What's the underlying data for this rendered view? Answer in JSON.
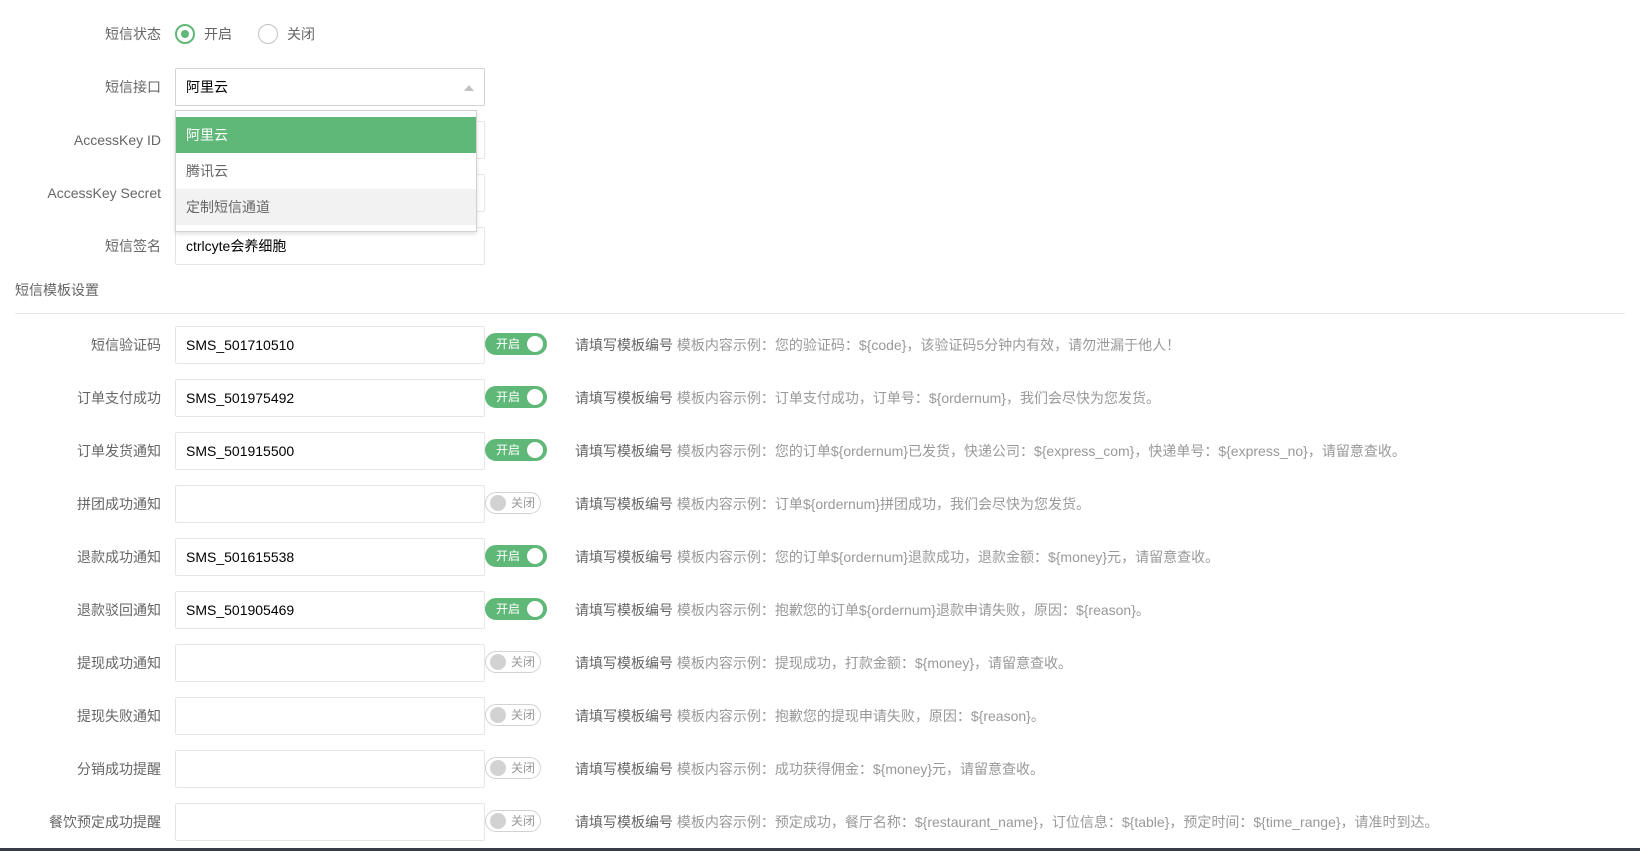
{
  "sms_status": {
    "label": "短信状态",
    "options": [
      {
        "label": "开启",
        "checked": true
      },
      {
        "label": "关闭",
        "checked": false
      }
    ]
  },
  "sms_gateway": {
    "label": "短信接口",
    "value": "阿里云",
    "options": [
      "阿里云",
      "腾讯云",
      "定制短信通道"
    ],
    "selected_index": 0,
    "hover_index": 2
  },
  "access_key_id": {
    "label": "AccessKey ID",
    "value": ""
  },
  "access_key_secret": {
    "label": "AccessKey Secret",
    "value": ""
  },
  "sms_sign": {
    "label": "短信签名",
    "value": "ctrlcyte会养细胞"
  },
  "template_section": {
    "title": "短信模板设置"
  },
  "switch_labels": {
    "on": "开启",
    "off": "关闭"
  },
  "tip_prefix": "请填写模板编号",
  "templates": [
    {
      "label": "短信验证码",
      "value": "SMS_501710510",
      "enabled": true,
      "example": "模板内容示例：您的验证码：${code}，该验证码5分钟内有效，请勿泄漏于他人！"
    },
    {
      "label": "订单支付成功",
      "value": "SMS_501975492",
      "enabled": true,
      "example": "模板内容示例：订单支付成功，订单号：${ordernum}，我们会尽快为您发货。"
    },
    {
      "label": "订单发货通知",
      "value": "SMS_501915500",
      "enabled": true,
      "example": "模板内容示例：您的订单${ordernum}已发货，快递公司：${express_com}，快递单号：${express_no}，请留意查收。"
    },
    {
      "label": "拼团成功通知",
      "value": "",
      "enabled": false,
      "example": "模板内容示例：订单${ordernum}拼团成功，我们会尽快为您发货。"
    },
    {
      "label": "退款成功通知",
      "value": "SMS_501615538",
      "enabled": true,
      "example": "模板内容示例：您的订单${ordernum}退款成功，退款金额：${money}元，请留意查收。"
    },
    {
      "label": "退款驳回通知",
      "value": "SMS_501905469",
      "enabled": true,
      "example": "模板内容示例：抱歉您的订单${ordernum}退款申请失败，原因：${reason}。"
    },
    {
      "label": "提现成功通知",
      "value": "",
      "enabled": false,
      "example": "模板内容示例：提现成功，打款金额：${money}，请留意查收。"
    },
    {
      "label": "提现失败通知",
      "value": "",
      "enabled": false,
      "example": "模板内容示例：抱歉您的提现申请失败，原因：${reason}。"
    },
    {
      "label": "分销成功提醒",
      "value": "",
      "enabled": false,
      "example": "模板内容示例：成功获得佣金：${money}元，请留意查收。"
    },
    {
      "label": "餐饮预定成功提醒",
      "value": "",
      "enabled": false,
      "example": "模板内容示例：预定成功，餐厅名称：${restaurant_name}，订位信息：${table}，预定时间：${time_range}，请准时到达。"
    }
  ],
  "colors": {
    "accent": "#5fb878",
    "border": "#e6e6e6",
    "label": "#666666"
  }
}
